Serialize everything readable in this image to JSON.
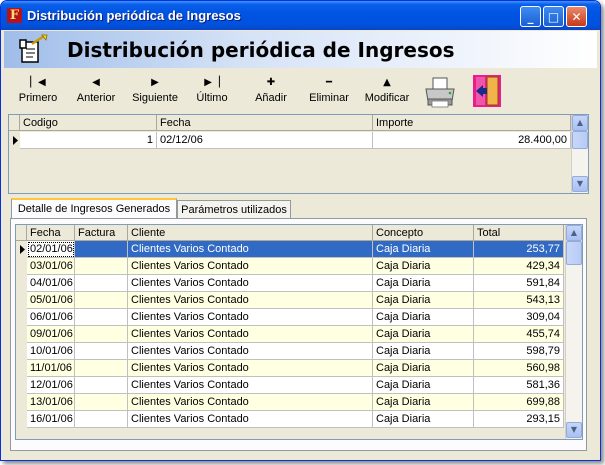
{
  "window": {
    "title": "Distribución periódica de Ingresos",
    "minimize_glyph": "_",
    "maximize_glyph": "□",
    "close_glyph": "✕"
  },
  "header": {
    "title": "Distribución periódica de Ingresos",
    "icon": "document-wand-icon"
  },
  "toolbar": {
    "buttons": [
      {
        "label": "Primero",
        "glyph": "▏◀",
        "icon": "first-record-icon"
      },
      {
        "label": "Anterior",
        "glyph": "◀",
        "icon": "previous-record-icon"
      },
      {
        "label": "Siguiente",
        "glyph": "▶",
        "icon": "next-record-icon"
      },
      {
        "label": "Último",
        "glyph": "▶▕",
        "icon": "last-record-icon"
      },
      {
        "label": "Añadir",
        "glyph": "✚",
        "icon": "add-icon"
      },
      {
        "label": "Eliminar",
        "glyph": "━",
        "icon": "delete-icon"
      },
      {
        "label": "Modificar",
        "glyph": "▲",
        "icon": "modify-icon"
      }
    ],
    "print_icon": "printer-icon",
    "exit_icon": "exit-door-icon"
  },
  "top_grid": {
    "columns": [
      "Codigo",
      "Fecha",
      "Importe"
    ],
    "rows": [
      {
        "codigo": "1",
        "fecha": "02/12/06",
        "importe": "28.400,00"
      }
    ]
  },
  "tabs": [
    {
      "label": "Detalle de Ingresos Generados",
      "active": true
    },
    {
      "label": "Parámetros utilizados",
      "active": false
    }
  ],
  "detail_grid": {
    "columns": [
      "Fecha",
      "Factura",
      "Cliente",
      "Concepto",
      "Total"
    ],
    "rows": [
      {
        "fecha": "02/01/06",
        "factura": "",
        "cliente": "Clientes Varios Contado",
        "concepto": "Caja Diaria",
        "total": "253,77"
      },
      {
        "fecha": "03/01/06",
        "factura": "",
        "cliente": "Clientes Varios Contado",
        "concepto": "Caja Diaria",
        "total": "429,34"
      },
      {
        "fecha": "04/01/06",
        "factura": "",
        "cliente": "Clientes Varios Contado",
        "concepto": "Caja Diaria",
        "total": "591,84"
      },
      {
        "fecha": "05/01/06",
        "factura": "",
        "cliente": "Clientes Varios Contado",
        "concepto": "Caja Diaria",
        "total": "543,13"
      },
      {
        "fecha": "06/01/06",
        "factura": "",
        "cliente": "Clientes Varios Contado",
        "concepto": "Caja Diaria",
        "total": "309,04"
      },
      {
        "fecha": "09/01/06",
        "factura": "",
        "cliente": "Clientes Varios Contado",
        "concepto": "Caja Diaria",
        "total": "455,74"
      },
      {
        "fecha": "10/01/06",
        "factura": "",
        "cliente": "Clientes Varios Contado",
        "concepto": "Caja Diaria",
        "total": "598,79"
      },
      {
        "fecha": "11/01/06",
        "factura": "",
        "cliente": "Clientes Varios Contado",
        "concepto": "Caja Diaria",
        "total": "560,98"
      },
      {
        "fecha": "12/01/06",
        "factura": "",
        "cliente": "Clientes Varios Contado",
        "concepto": "Caja Diaria",
        "total": "581,36"
      },
      {
        "fecha": "13/01/06",
        "factura": "",
        "cliente": "Clientes Varios Contado",
        "concepto": "Caja Diaria",
        "total": "699,88"
      },
      {
        "fecha": "16/01/06",
        "factura": "",
        "cliente": "Clientes Varios Contado",
        "concepto": "Caja Diaria",
        "total": "293,15"
      }
    ]
  },
  "colors": {
    "title_blue": "#0054e3",
    "selected_row": "#316ac5",
    "alt_row": "#ffffe1",
    "tab_highlight": "#ffc83c"
  }
}
